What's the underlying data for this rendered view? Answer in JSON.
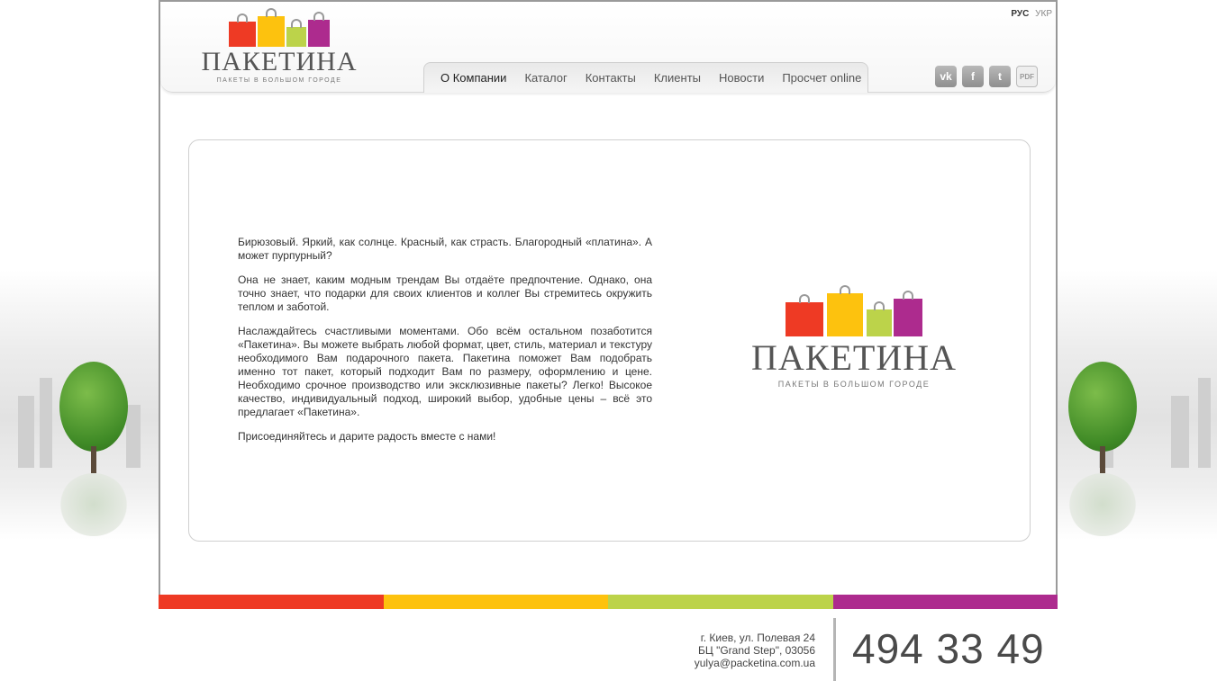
{
  "header": {
    "logo": {
      "title": "ПАКЕТИНА",
      "subtitle": "ПАКЕТЫ В БОЛЬШОМ ГОРОДЕ"
    },
    "lang": {
      "active": "РУС",
      "inactive": "УКР"
    },
    "nav": [
      {
        "label": "О Компании"
      },
      {
        "label": "Каталог"
      },
      {
        "label": "Контакты"
      },
      {
        "label": "Клиенты"
      },
      {
        "label": "Новости"
      },
      {
        "label": "Просчет online"
      }
    ],
    "social": {
      "vk": "vk",
      "facebook": "f",
      "twitter": "t",
      "pdf": "PDF"
    }
  },
  "main": {
    "paragraphs": [
      "Бирюзовый. Яркий, как солнце. Красный, как страсть. Благородный «платина». А может пурпурный?",
      " Она не знает, каким модным трендам Вы отдаёте предпочтение. Однако, она точно знает, что подарки для своих клиентов и коллег Вы стремитесь окружить теплом и заботой.",
      " Наслаждайтесь счастливыми моментами. Обо всём остальном позаботится «Пакетина». Вы можете выбрать любой формат, цвет, стиль, материал и текстуру необходимого Вам подарочного пакета. Пакетина поможет Вам подобрать именно тот пакет, который подходит Вам по размеру, оформлению и цене. Необходимо срочное производство или эксклюзивные пакеты? Легко! Высокое качество, индивидуальный подход, широкий выбор, удобные цены – всё это предлагает «Пакетина».",
      " Присоединяйтесь и дарите радость вместе с нами!"
    ],
    "logo": {
      "title": "ПАКЕТИНА",
      "subtitle": "ПАКЕТЫ В БОЛЬШОМ ГОРОДЕ"
    }
  },
  "colors": {
    "red": "#ee3a24",
    "yellow": "#fdc20e",
    "green": "#bcd34a",
    "purple": "#ad2b8e"
  },
  "footer": {
    "address_line1": "г. Киев, ул. Полевая 24",
    "address_line2": "БЦ \"Grand Step\", 03056",
    "email": "yulya@packetina.com.ua",
    "phone": "494 33 49"
  }
}
